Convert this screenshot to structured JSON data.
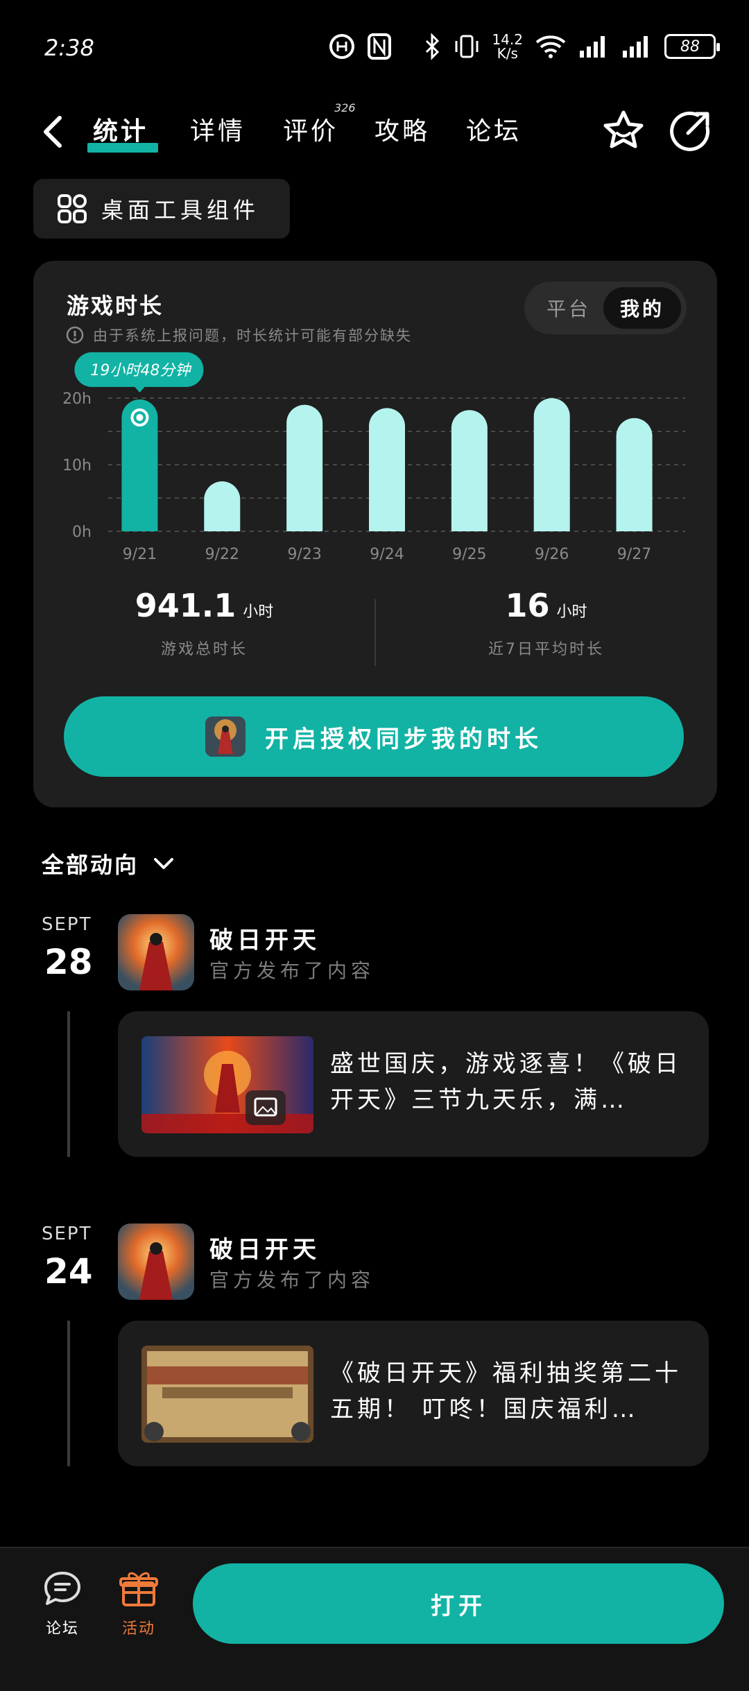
{
  "status_bar": {
    "time": "2:38",
    "net_speed": "14.2\nK/s",
    "battery": "88"
  },
  "nav": {
    "tabs": [
      {
        "label": "统计",
        "active": true
      },
      {
        "label": "详情"
      },
      {
        "label": "评价",
        "badge": "326"
      },
      {
        "label": "攻略"
      },
      {
        "label": "论坛"
      }
    ]
  },
  "widget_chip": {
    "label": "桌面工具组件"
  },
  "stats": {
    "title": "游戏时长",
    "note": "由于系统上报问题，时长统计可能有部分缺失",
    "toggle": {
      "platform": "平台",
      "mine": "我的",
      "selected": "mine"
    },
    "tooltip": "19小时48分钟",
    "total_value": "941.1",
    "total_unit": "小时",
    "total_caption": "游戏总时长",
    "avg_value": "16",
    "avg_unit": "小时",
    "avg_caption": "近7日平均时长",
    "sync_button": "开启授权同步我的时长"
  },
  "chart_data": {
    "type": "bar",
    "categories": [
      "9/21",
      "9/22",
      "9/23",
      "9/24",
      "9/25",
      "9/26",
      "9/27"
    ],
    "values": [
      19.8,
      7.5,
      19,
      18.5,
      18.2,
      20,
      17
    ],
    "yticks": [
      "0h",
      "10h",
      "20h"
    ],
    "ylim": [
      0,
      20
    ],
    "highlight_index": 0,
    "colors": {
      "bar": "#b5f3ee",
      "highlight": "#12b3a4",
      "grid": "#4a4a4a"
    }
  },
  "feed": {
    "header": "全部动向",
    "posts": [
      {
        "month": "SEPT",
        "day": "28",
        "name": "破日开天",
        "sub": "官方发布了内容",
        "text": "盛世国庆，游戏逐喜！《破日开天》三节九天乐，满…"
      },
      {
        "month": "SEPT",
        "day": "24",
        "name": "破日开天",
        "sub": "官方发布了内容",
        "text": "《破日开天》福利抽奖第二十五期！ 叮咚！国庆福利…"
      }
    ]
  },
  "bottom_bar": {
    "forum": "论坛",
    "activity": "活动",
    "open": "打开"
  },
  "colors": {
    "accent": "#12b3a4",
    "activity": "#f07a3a"
  }
}
